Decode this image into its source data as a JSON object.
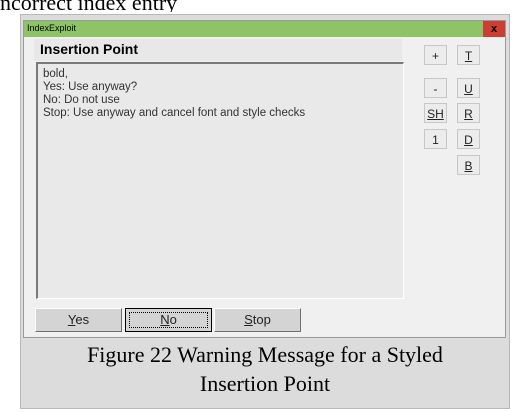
{
  "page_heading": "ncorrect index entry",
  "window": {
    "title": "IndexExploit",
    "close_glyph": "x",
    "header_title": "Insertion Point"
  },
  "message": {
    "lines": [
      "bold,",
      "",
      "Yes: Use anyway?",
      "No: Do not use",
      "Stop: Use anyway and cancel font and style checks"
    ]
  },
  "side_buttons_left": [
    "+",
    "-",
    "SH",
    "1"
  ],
  "side_buttons_right": [
    "T",
    "U",
    "R",
    "D",
    "B"
  ],
  "buttons": {
    "yes": {
      "ul": "Y",
      "rest": "es"
    },
    "no": {
      "ul": "N",
      "rest": "o"
    },
    "stop": {
      "ul": "S",
      "rest": "top"
    }
  },
  "caption": {
    "line1": "Figure 22 Warning Message for a Styled",
    "line2": "Insertion Point"
  },
  "colors": {
    "titlebar": "#8dc466",
    "close_button": "#cc3d33",
    "window_bg": "#f0f0f0",
    "figure_bg": "#dcdcdc"
  }
}
